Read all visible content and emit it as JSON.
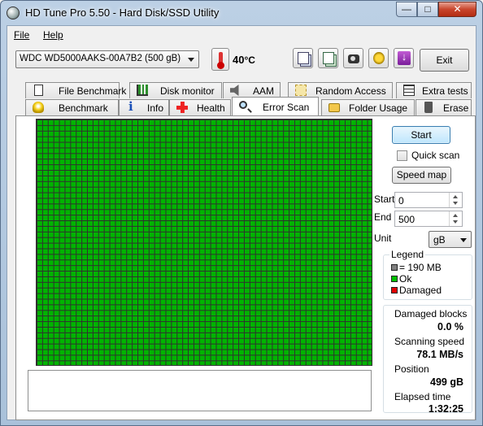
{
  "window": {
    "title": "HD Tune Pro 5.50 - Hard Disk/SSD Utility",
    "controls": {
      "minimize": "—",
      "maximize": "□",
      "close": "✕"
    }
  },
  "menu": {
    "file": "File",
    "help": "Help"
  },
  "toolbar": {
    "drive": "WDC WD5000AAKS-00A7B2 (500 gB)",
    "temperature": "40",
    "temperature_unit": "°C",
    "exit_label": "Exit",
    "buttons": [
      "copy-info-icon",
      "save-icon",
      "camera-icon",
      "options-icon",
      "download-icon"
    ]
  },
  "tabs": {
    "top_row": [
      "File Benchmark",
      "Disk monitor",
      "AAM",
      "Random Access",
      "Extra tests"
    ],
    "bottom_row": [
      "Benchmark",
      "Info",
      "Health",
      "Error Scan",
      "Folder Usage",
      "Erase"
    ],
    "active": "Error Scan"
  },
  "error_scan": {
    "start_button": "Start",
    "quick_scan_label": "Quick scan",
    "quick_scan_checked": false,
    "speed_map_button": "Speed map",
    "start_label": "Start",
    "start_value": "0",
    "end_label": "End",
    "end_value": "500",
    "unit_label": "Unit",
    "unit_value": "gB",
    "legend": {
      "title": "Legend",
      "block": "= 190 MB",
      "ok": "Ok",
      "damaged": "Damaged"
    },
    "stats": {
      "damaged_blocks_label": "Damaged blocks",
      "damaged_blocks_value": "0.0 %",
      "scanning_speed_label": "Scanning speed",
      "scanning_speed_value": "78.1 MB/s",
      "position_label": "Position",
      "position_value": "499 gB",
      "elapsed_label": "Elapsed time",
      "elapsed_value": "1:32:25"
    },
    "colors": {
      "ok": "#00b400",
      "damaged": "#e00000",
      "block": "#808080"
    }
  }
}
